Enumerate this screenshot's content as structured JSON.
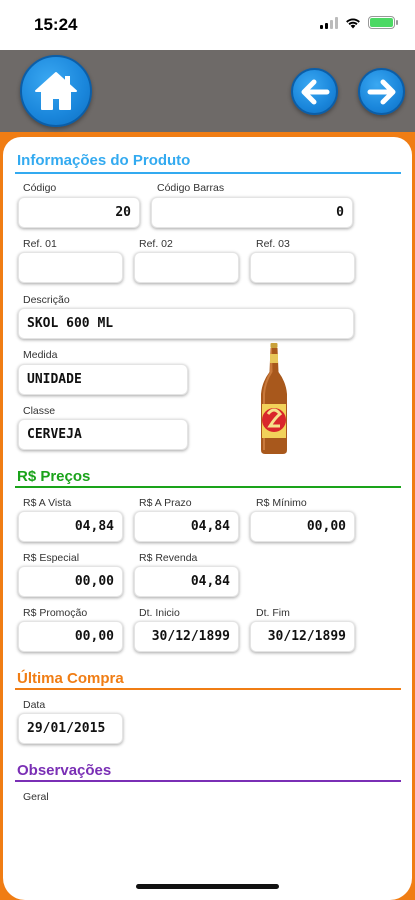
{
  "status_bar": {
    "time": "15:24"
  },
  "toolbar": {
    "home_icon": "home-icon",
    "back_icon": "arrow-left-icon",
    "next_icon": "arrow-right-icon"
  },
  "colors": {
    "toolbar": "#6e6a68",
    "accent_orange": "#f07d14",
    "button_blue": "#1a86db",
    "produto": "#33aaf0",
    "precos": "#1aa31a",
    "compra": "#f07d14",
    "obs": "#7a2fb5"
  },
  "produto": {
    "title": "Informações do Produto",
    "codigo_label": "Código",
    "codigo": "20",
    "codigo_barras_label": "Código Barras",
    "codigo_barras": "0",
    "ref01_label": "Ref. 01",
    "ref01": "",
    "ref02_label": "Ref. 02",
    "ref02": "",
    "ref03_label": "Ref. 03",
    "ref03": "",
    "descricao_label": "Descrição",
    "descricao": "SKOL 600 ML",
    "medida_label": "Medida",
    "medida": "UNIDADE",
    "classe_label": "Classe",
    "classe": "CERVEJA"
  },
  "precos": {
    "title": "R$ Preços",
    "avista_label": "R$ A Vista",
    "avista": "04,84",
    "aprazo_label": "R$ A Prazo",
    "aprazo": "04,84",
    "minimo_label": "R$ Mínimo",
    "minimo": "00,00",
    "especial_label": "R$ Especial",
    "especial": "00,00",
    "revenda_label": "R$ Revenda",
    "revenda": "04,84",
    "promocao_label": "R$ Promoção",
    "promocao": "00,00",
    "dt_inicio_label": "Dt. Inicio",
    "dt_inicio": "30/12/1899",
    "dt_fim_label": "Dt. Fim",
    "dt_fim": "30/12/1899"
  },
  "compra": {
    "title": "Última Compra",
    "data_label": "Data",
    "data": "29/01/2015"
  },
  "observacoes": {
    "title": "Observações",
    "geral_label": "Geral"
  }
}
